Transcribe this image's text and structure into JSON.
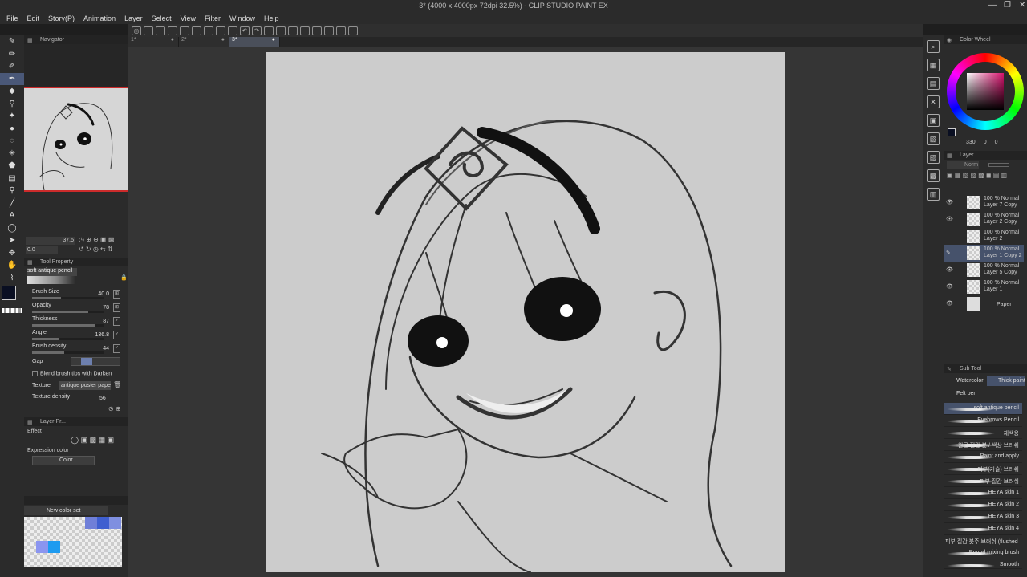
{
  "app": {
    "title": "3* (4000 x 4000px 72dpi 32.5%) - CLIP STUDIO PAINT EX",
    "menu": [
      "File",
      "Edit",
      "Story(P)",
      "Animation",
      "Layer",
      "Select",
      "View",
      "Filter",
      "Window",
      "Help"
    ]
  },
  "tabs": [
    {
      "label": "1*"
    },
    {
      "label": "2*"
    },
    {
      "label": "3*"
    }
  ],
  "navigator": {
    "title": "Navigator",
    "zoom": "37.5",
    "rotation": "0.0"
  },
  "tool_property": {
    "title": "Tool Property",
    "brush_name": "soft antique pencil",
    "params": [
      {
        "label": "Brush Size",
        "value": "40.0",
        "fill": 0.4
      },
      {
        "label": "Opacity",
        "value": "78",
        "fill": 0.78
      },
      {
        "label": "Thickness",
        "value": "87",
        "fill": 0.87
      },
      {
        "label": "Angle",
        "value": "136.8",
        "fill": 0.38
      },
      {
        "label": "Brush density",
        "value": "44",
        "fill": 0.44
      }
    ],
    "gap_label": "Gap",
    "blend_label": "Blend brush tips with Darken",
    "texture_label": "Texture",
    "texture_value": "antique poster paper",
    "texture_density_label": "Texture density",
    "texture_density_value": "56"
  },
  "layer_property": {
    "title": "Layer Pr...",
    "effect_label": "Effect",
    "expression_label": "Expression color",
    "expression_value": "Color"
  },
  "color_set": {
    "name": "New color set",
    "swatches": [
      "#6f7fd8",
      "#3f5fd0",
      "#7f8fe0",
      "#8b95f0",
      "#1e9bf0"
    ]
  },
  "color_wheel": {
    "title": "Color Wheel",
    "values": [
      "330",
      "0",
      "0"
    ]
  },
  "layers_panel": {
    "title": "Layer",
    "blend": "Norm",
    "layers": [
      {
        "line1": "100 % Normal",
        "line2": "Layer 7 Copy",
        "visible": true,
        "selected": false
      },
      {
        "line1": "100 % Normal",
        "line2": "Layer 2 Copy",
        "visible": true,
        "selected": false
      },
      {
        "line1": "100 % Normal",
        "line2": "Layer 2",
        "visible": false,
        "selected": false
      },
      {
        "line1": "100 % Normal",
        "line2": "Layer 1 Copy 2",
        "visible": false,
        "selected": true
      },
      {
        "line1": "100 % Normal",
        "line2": "Layer 5 Copy",
        "visible": true,
        "selected": false
      },
      {
        "line1": "100 % Normal",
        "line2": "Layer 1",
        "visible": true,
        "selected": false
      },
      {
        "line1": "",
        "line2": "Paper",
        "visible": true,
        "selected": false
      }
    ]
  },
  "sub_tool": {
    "title": "Sub Tool",
    "groups": [
      "Watercolor",
      "Thick paint",
      "Felt pen"
    ],
    "brushes": [
      {
        "name": "soft antique pencil",
        "selected": true
      },
      {
        "name": "Eyebrows Pencil",
        "selected": false
      },
      {
        "name": "채색용",
        "selected": false
      },
      {
        "name": "원근 질감 붓 / 색상 브러쉬",
        "selected": false
      },
      {
        "name": "Paint and apply",
        "selected": false
      },
      {
        "name": "피부(기술) 브러쉬",
        "selected": false
      },
      {
        "name": "피부 질감 브러쉬",
        "selected": false
      },
      {
        "name": "HEYA skin 1",
        "selected": false
      },
      {
        "name": "HEYA skin 2",
        "selected": false
      },
      {
        "name": "HEYA skin 3",
        "selected": false
      },
      {
        "name": "HEYA skin 4",
        "selected": false
      },
      {
        "name": "피부 질감 붓주 브러쉬 (flushed ski",
        "selected": false
      },
      {
        "name": "Round mixing brush",
        "selected": false
      },
      {
        "name": "Smooth",
        "selected": false
      }
    ]
  }
}
